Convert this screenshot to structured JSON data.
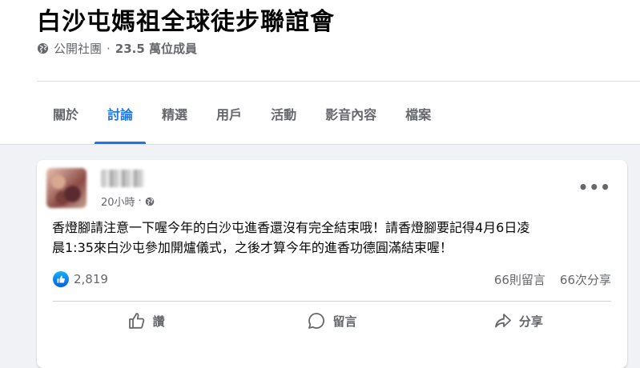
{
  "group": {
    "title": "白沙屯媽祖全球徒步聯誼會",
    "privacy": "公開社團",
    "separator": "·",
    "members": "23.5 萬位成員"
  },
  "tabs": [
    {
      "label": "關於"
    },
    {
      "label": "討論",
      "active": true
    },
    {
      "label": "精選"
    },
    {
      "label": "用戶"
    },
    {
      "label": "活動"
    },
    {
      "label": "影音內容"
    },
    {
      "label": "檔案"
    }
  ],
  "post": {
    "time": "20小時",
    "dot": "·",
    "text": "香燈腳請注意一下喔今年的白沙屯進香還沒有完全結束哦！請香燈腳要記得4月6日凌\n晨1:35來白沙屯參加開爐儀式，之後才算今年的進香功德圓滿結束喔！",
    "likes": "2,819",
    "comments": "66則留言",
    "shares": "66次分享",
    "more": "•••"
  },
  "actions": {
    "like": "讚",
    "comment": "留言",
    "share": "分享"
  },
  "colors": {
    "accent": "#1877f2",
    "secondary_text": "#65676b",
    "background": "#f0f2f5"
  }
}
